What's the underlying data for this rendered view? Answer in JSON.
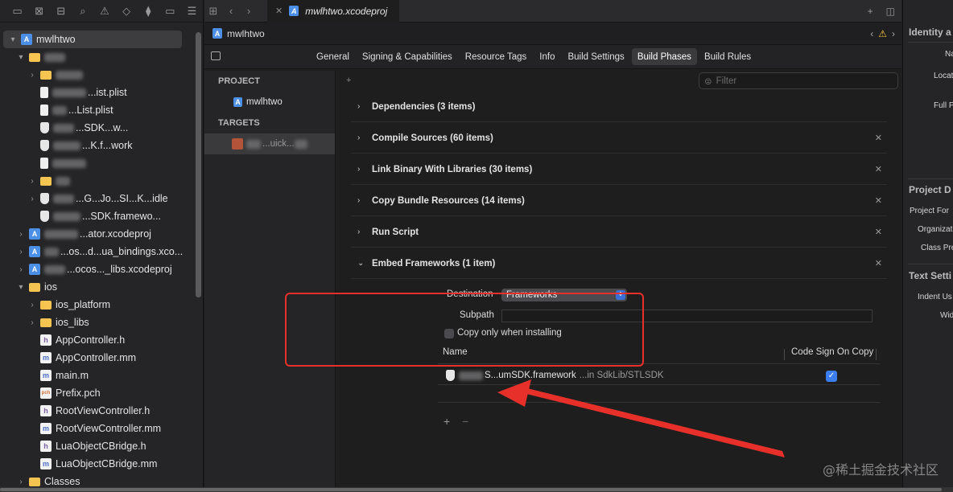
{
  "navigator": {
    "toolbar_icons": [
      "folder-icon",
      "xmark-square-icon",
      "hierarchy-icon",
      "search-icon",
      "warning-icon",
      "diamond-icon",
      "test-icon",
      "breakpoint-icon",
      "report-icon"
    ],
    "items": [
      {
        "label": "mwlhtwo",
        "icon": "proj",
        "indent": 0,
        "disclosure": "▾",
        "selected": true
      },
      {
        "label": "",
        "icon": "folder",
        "indent": 1,
        "disclosure": "▾"
      },
      {
        "label": "",
        "icon": "folder",
        "indent": 2,
        "disclosure": "›"
      },
      {
        "label": "...ist.plist",
        "icon": "plist",
        "indent": 2,
        "disclosure": ""
      },
      {
        "label": "...List.plist",
        "icon": "plist",
        "indent": 2,
        "disclosure": ""
      },
      {
        "label": "...SDK...w...",
        "icon": "shield",
        "indent": 2,
        "disclosure": ""
      },
      {
        "label": "...K.f...work",
        "icon": "shield",
        "indent": 2,
        "disclosure": ""
      },
      {
        "label": "",
        "icon": "plist",
        "indent": 2,
        "disclosure": ""
      },
      {
        "label": "",
        "icon": "folder",
        "indent": 2,
        "disclosure": "›"
      },
      {
        "label": "...G...Jo...SI...K...idle",
        "icon": "shield",
        "indent": 2,
        "disclosure": "›"
      },
      {
        "label": "...SDK.framewo...",
        "icon": "shield",
        "indent": 2,
        "disclosure": ""
      },
      {
        "label": "...ator.xcodeproj",
        "icon": "proj",
        "indent": 1,
        "disclosure": "›"
      },
      {
        "label": "...os...d...ua_bindings.xco...",
        "icon": "proj",
        "indent": 1,
        "disclosure": "›"
      },
      {
        "label": "...ocos..._libs.xcodeproj",
        "icon": "proj",
        "indent": 1,
        "disclosure": "›"
      },
      {
        "label": "ios",
        "icon": "folder",
        "indent": 1,
        "disclosure": "▾"
      },
      {
        "label": "ios_platform",
        "icon": "folder",
        "indent": 2,
        "disclosure": "›"
      },
      {
        "label": "ios_libs",
        "icon": "folder",
        "indent": 2,
        "disclosure": "›"
      },
      {
        "label": "AppController.h",
        "icon": "h",
        "indent": 2,
        "disclosure": ""
      },
      {
        "label": "AppController.mm",
        "icon": "m",
        "indent": 2,
        "disclosure": ""
      },
      {
        "label": "main.m",
        "icon": "m",
        "indent": 2,
        "disclosure": ""
      },
      {
        "label": "Prefix.pch",
        "icon": "pch",
        "indent": 2,
        "disclosure": ""
      },
      {
        "label": "RootViewController.h",
        "icon": "h",
        "indent": 2,
        "disclosure": ""
      },
      {
        "label": "RootViewController.mm",
        "icon": "m",
        "indent": 2,
        "disclosure": ""
      },
      {
        "label": "LuaObjectCBridge.h",
        "icon": "h",
        "indent": 2,
        "disclosure": ""
      },
      {
        "label": "LuaObjectCBridge.mm",
        "icon": "m",
        "indent": 2,
        "disclosure": ""
      },
      {
        "label": "Classes",
        "icon": "folder",
        "indent": 1,
        "disclosure": "›"
      }
    ]
  },
  "editor": {
    "tab_title": "mwlhtwo.xcodeproj",
    "jump_title": "mwlhtwo",
    "settings_tabs": [
      "General",
      "Signing & Capabilities",
      "Resource Tags",
      "Info",
      "Build Settings",
      "Build Phases",
      "Build Rules"
    ],
    "active_settings_tab": "Build Phases",
    "project_header": "PROJECT",
    "project_name": "mwlhtwo",
    "targets_header": "TARGETS",
    "target_name": "...uick...",
    "filter_placeholder": "Filter",
    "add_phase": "+",
    "phases": [
      {
        "title": "Dependencies (3 items)",
        "closable": false,
        "expanded": false
      },
      {
        "title": "Compile Sources (60 items)",
        "closable": true,
        "expanded": false
      },
      {
        "title": "Link Binary With Libraries (30 items)",
        "closable": true,
        "expanded": false
      },
      {
        "title": "Copy Bundle Resources (14 items)",
        "closable": true,
        "expanded": false
      },
      {
        "title": "Run Script",
        "closable": true,
        "expanded": false
      },
      {
        "title": "Embed Frameworks (1 item)",
        "closable": true,
        "expanded": true
      }
    ],
    "embed": {
      "destination_label": "Destination",
      "destination_value": "Frameworks",
      "subpath_label": "Subpath",
      "subpath_value": "",
      "copy_only_label": "Copy only when installing",
      "col_name": "Name",
      "col_codesign": "Code Sign On Copy",
      "framework_name": "S...umSDK.framework",
      "framework_path": "...in SdkLib/STLSDK",
      "codesign_checked": "✓",
      "add": "+",
      "remove": "−"
    }
  },
  "inspector": {
    "identity_header": "Identity a",
    "identity_labels": [
      "Na",
      "Locat",
      "Full P"
    ],
    "project_doc_header": "Project D",
    "project_doc_labels": [
      "Project For",
      "Organizat",
      "Class Pre"
    ],
    "text_settings_header": "Text Setti",
    "text_settings_labels": [
      "Indent Us",
      "Wid"
    ]
  },
  "watermark": "@稀土掘金技术社区",
  "colors": {
    "annotation_red": "#e8302a",
    "accent_blue": "#3b7ef0",
    "folder_yellow": "#f5c451"
  }
}
